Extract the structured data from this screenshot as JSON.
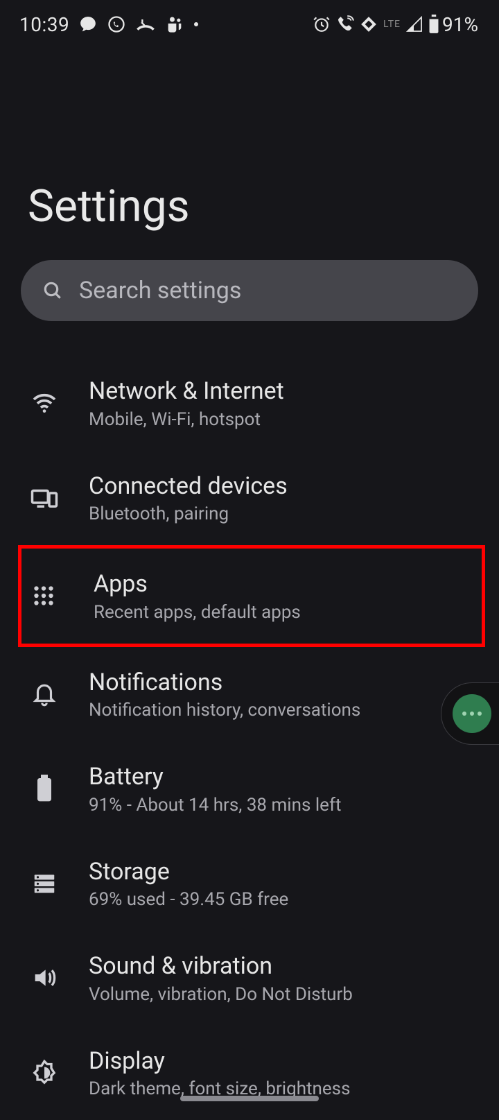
{
  "status_bar": {
    "time": "10:39",
    "lte_label": "LTE",
    "battery_label": "91%"
  },
  "page_title": "Settings",
  "search": {
    "placeholder": "Search settings"
  },
  "items": [
    {
      "title": "Network & Internet",
      "subtitle": "Mobile, Wi-Fi, hotspot"
    },
    {
      "title": "Connected devices",
      "subtitle": "Bluetooth, pairing"
    },
    {
      "title": "Apps",
      "subtitle": "Recent apps, default apps"
    },
    {
      "title": "Notifications",
      "subtitle": "Notification history, conversations"
    },
    {
      "title": "Battery",
      "subtitle": "91% - About 14 hrs, 38 mins left"
    },
    {
      "title": "Storage",
      "subtitle": "69% used - 39.45 GB free"
    },
    {
      "title": "Sound & vibration",
      "subtitle": "Volume, vibration, Do Not Disturb"
    },
    {
      "title": "Display",
      "subtitle": "Dark theme, font size, brightness"
    }
  ]
}
